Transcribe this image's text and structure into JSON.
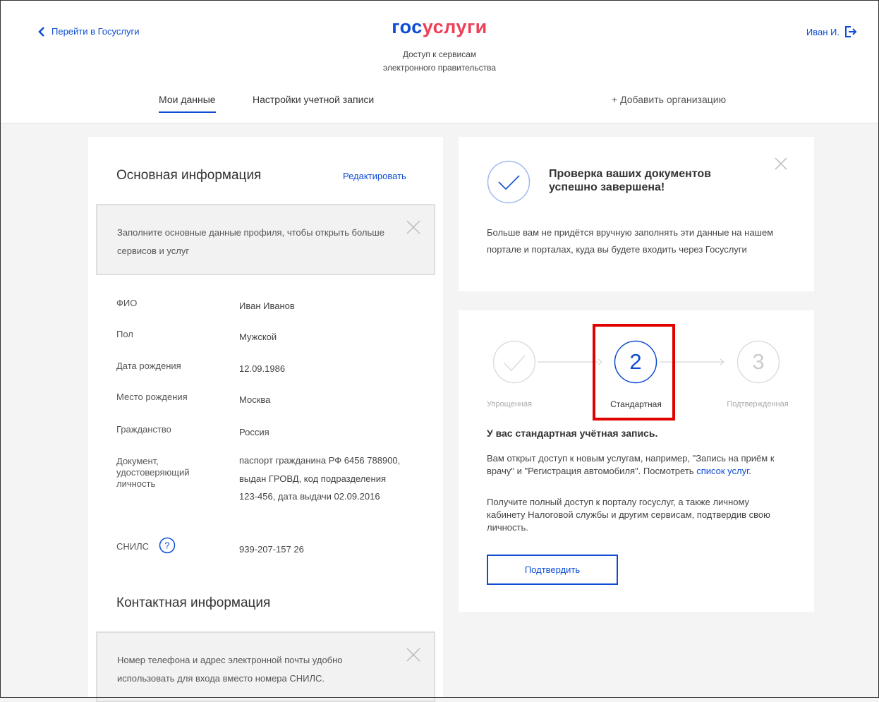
{
  "header": {
    "back_link": "Перейти в Госуслуги",
    "logo_part1": "гос",
    "logo_part2": "услуги",
    "subtitle_line1": "Доступ к сервисам",
    "subtitle_line2": "электронного правительства",
    "user_name": "Иван И.",
    "tabs": [
      {
        "label": "Мои данные",
        "active": true
      },
      {
        "label": "Настройки учетной записи",
        "active": false
      }
    ],
    "add_org": "+ Добавить организацию"
  },
  "basic_info": {
    "title": "Основная информация",
    "edit_label": "Редактировать",
    "notice": "Заполните основные данные профиля, чтобы открыть больше сервисов и услуг",
    "fields": [
      {
        "label": "ФИО",
        "value": "Иван Иванов"
      },
      {
        "label": "Пол",
        "value": "Мужской"
      },
      {
        "label": "Дата рождения",
        "value": "12.09.1986"
      },
      {
        "label": "Место рождения",
        "value": "Москва"
      },
      {
        "label": "Гражданство",
        "value": "Россия"
      },
      {
        "label": "Документ, удостоверяющий личность",
        "value": "паспорт гражданина РФ 6456 788900, выдан ГРОВД, код подразделения 123-456, дата выдачи 02.09.2016"
      },
      {
        "label": "СНИЛС",
        "value": "939-207-157 26"
      }
    ]
  },
  "contact_info": {
    "title": "Контактная информация",
    "notice": "Номер телефона и адрес электронной почты удобно использовать для входа вместо номера СНИЛС."
  },
  "verification": {
    "title": "Проверка ваших документов успешно завершена!",
    "text": "Больше вам не придётся вручную заполнять эти данные на нашем портале и порталах, куда вы будете входить через Госуслуги"
  },
  "account_level": {
    "steps": [
      {
        "number": "",
        "label": "Упрощенная",
        "state": "done"
      },
      {
        "number": "2",
        "label": "Стандартная",
        "state": "current"
      },
      {
        "number": "3",
        "label": "Подтвержденная",
        "state": "pending"
      }
    ],
    "title": "У вас стандартная учётная запись.",
    "para1": "Вам открыт доступ к новым услугам, например, \"Запись на приём к врачу\" и \"Регистрация автомобиля\". Посмотреть",
    "para1_link": "список услуг",
    "para1_end": ".",
    "para2": "Получите полный доступ к порталу госуслуг, а также личному кабинету Налоговой службы и другим сервисам, подтвердив свою личность.",
    "confirm_label": "Подтвердить"
  },
  "colors": {
    "accent": "#0d4cd3",
    "brand_red": "#ee3f58",
    "highlight": "#e00000",
    "background": "#f4f4f4"
  }
}
